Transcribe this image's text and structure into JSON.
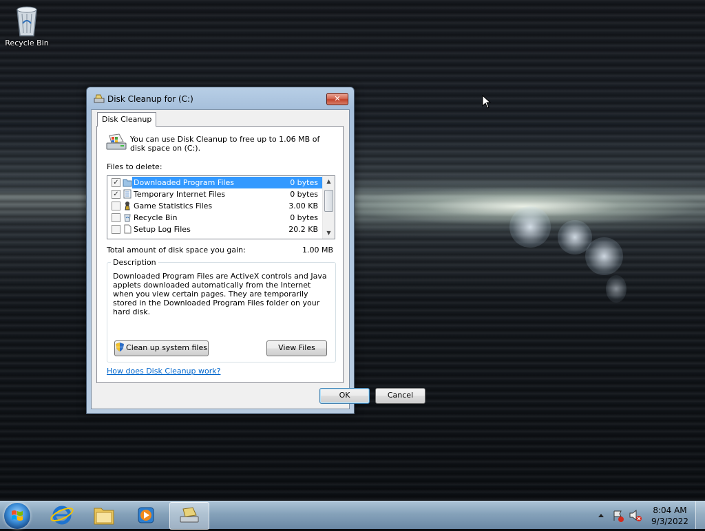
{
  "desktop": {
    "icons": [
      {
        "label": "Recycle Bin",
        "icon": "recycle-bin-icon"
      }
    ]
  },
  "dialog": {
    "title": "Disk Cleanup for  (C:)",
    "close_label": "✕",
    "tab": "Disk Cleanup",
    "intro": "You can use Disk Cleanup to free up to 1.06 MB of disk space on  (C:).",
    "files_label": "Files to delete:",
    "files": [
      {
        "name": "Downloaded Program Files",
        "size": "0 bytes",
        "checked": true,
        "selected": true,
        "icon": "folder-icon"
      },
      {
        "name": "Temporary Internet Files",
        "size": "0 bytes",
        "checked": true,
        "selected": false,
        "icon": "document-icon"
      },
      {
        "name": "Game Statistics Files",
        "size": "3.00 KB",
        "checked": false,
        "selected": false,
        "icon": "chess-piece-icon"
      },
      {
        "name": "Recycle Bin",
        "size": "0 bytes",
        "checked": false,
        "selected": false,
        "icon": "recycle-bin-icon"
      },
      {
        "name": "Setup Log Files",
        "size": "20.2 KB",
        "checked": false,
        "selected": false,
        "icon": "file-icon"
      }
    ],
    "total_label": "Total amount of disk space you gain:",
    "total_value": "1.00 MB",
    "description_title": "Description",
    "description": "Downloaded Program Files are ActiveX controls and Java applets downloaded automatically from the Internet when you view certain pages. They are temporarily stored in the Downloaded Program Files folder on your hard disk.",
    "cleanup_button": "Clean up system files",
    "view_files_button": "View Files",
    "help_link": "How does Disk Cleanup work?",
    "ok_button": "OK",
    "cancel_button": "Cancel"
  },
  "taskbar": {
    "pinned": [
      "internet-explorer-icon",
      "windows-explorer-icon",
      "media-player-icon",
      "disk-cleanup-icon"
    ],
    "clock_time": "8:04 AM",
    "clock_date": "9/3/2022"
  }
}
